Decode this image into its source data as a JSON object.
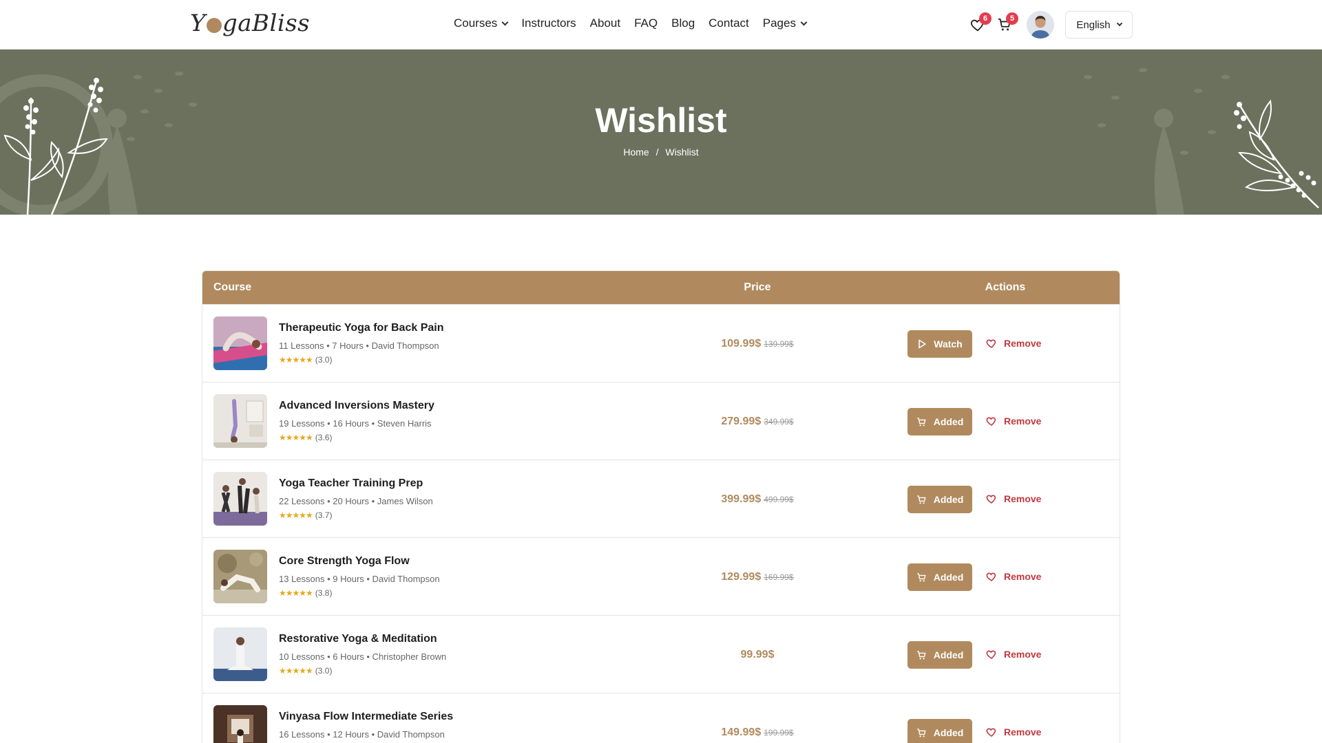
{
  "header": {
    "logo": "YogaBliss",
    "nav": [
      {
        "label": "Courses",
        "dropdown": true
      },
      {
        "label": "Instructors",
        "dropdown": false
      },
      {
        "label": "About",
        "dropdown": false
      },
      {
        "label": "FAQ",
        "dropdown": false
      },
      {
        "label": "Blog",
        "dropdown": false
      },
      {
        "label": "Contact",
        "dropdown": false
      },
      {
        "label": "Pages",
        "dropdown": true
      }
    ],
    "wishlist_count": "6",
    "cart_count": "5",
    "language": "English"
  },
  "hero": {
    "title": "Wishlist",
    "breadcrumb": {
      "home": "Home",
      "separator": "/",
      "current": "Wishlist"
    }
  },
  "table": {
    "headers": {
      "course": "Course",
      "price": "Price",
      "actions": "Actions"
    },
    "rows": [
      {
        "title": "Therapeutic Yoga for Back Pain",
        "meta": "11 Lessons • 7 Hours • David Thompson",
        "rating": "(3.0)",
        "price": "109.99$",
        "old_price": "139.99$",
        "action": "Watch",
        "action_icon": "play-icon",
        "remove": "Remove"
      },
      {
        "title": "Advanced Inversions Mastery",
        "meta": "19 Lessons • 16 Hours • Steven Harris",
        "rating": "(3.6)",
        "price": "279.99$",
        "old_price": "349.99$",
        "action": "Added",
        "action_icon": "cart-icon",
        "remove": "Remove"
      },
      {
        "title": "Yoga Teacher Training Prep",
        "meta": "22 Lessons • 20 Hours • James Wilson",
        "rating": "(3.7)",
        "price": "399.99$",
        "old_price": "499.99$",
        "action": "Added",
        "action_icon": "cart-icon",
        "remove": "Remove"
      },
      {
        "title": "Core Strength Yoga Flow",
        "meta": "13 Lessons • 9 Hours • David Thompson",
        "rating": "(3.8)",
        "price": "129.99$",
        "old_price": "169.99$",
        "action": "Added",
        "action_icon": "cart-icon",
        "remove": "Remove"
      },
      {
        "title": "Restorative Yoga & Meditation",
        "meta": "10 Lessons • 6 Hours • Christopher Brown",
        "rating": "(3.0)",
        "price": "99.99$",
        "old_price": "",
        "action": "Added",
        "action_icon": "cart-icon",
        "remove": "Remove"
      },
      {
        "title": "Vinyasa Flow Intermediate Series",
        "meta": "16 Lessons • 12 Hours • David Thompson",
        "rating": "",
        "price": "149.99$",
        "old_price": "199.99$",
        "action": "Added",
        "action_icon": "cart-icon",
        "remove": "Remove"
      }
    ]
  },
  "colors": {
    "accent": "#b08a5e",
    "hero_bg": "#6b715d",
    "remove": "#c0393f",
    "badge": "#e23d4f",
    "star": "#e6a91d"
  }
}
